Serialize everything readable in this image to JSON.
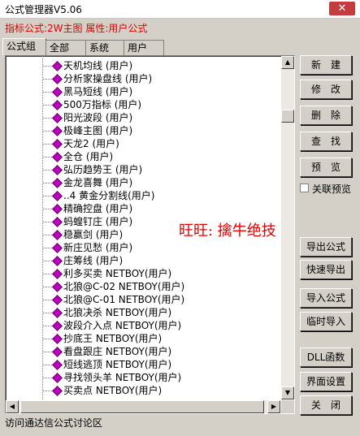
{
  "window": {
    "title": "公式管理器V5.06",
    "close_label": "✕"
  },
  "subtitle": "指标公式:2W主图 属性:用户公式",
  "tabs": [
    {
      "label": "公式组"
    },
    {
      "label": "全部"
    },
    {
      "label": "系统"
    },
    {
      "label": "用户"
    }
  ],
  "tree_items": [
    "天机均线  (用户)",
    "分析家操盘线  (用户)",
    "黑马短线  (用户)",
    "500万指标  (用户)",
    "阳光波段  (用户)",
    "极峰主图  (用户)",
    "天龙2  (用户)",
    "全仓  (用户)",
    "弘历趋势王  (用户)",
    "金龙喜舞  (用户)",
    "..4  黄金分割线(用户)",
    "精确控盘  (用户)",
    "蚂蝗钉庄  (用户)",
    "稳赢剑  (用户)",
    "新庄见愁  (用户)",
    "庄筹线  (用户)",
    "利多买卖  NETBOY(用户)",
    "北狼@C-02  NETBOY(用户)",
    "北狼@C-01  NETBOY(用户)",
    "北狼决杀  NETBOY(用户)",
    "波段介入点  NETBOY(用户)",
    "抄底王  NETBOY(用户)",
    "看盘跟庄  NETBOY(用户)",
    "短线逃顶  NETBOY(用户)",
    "寻找领头羊  NETBOY(用户)",
    "买卖点  NETBOY(用户)"
  ],
  "buttons": {
    "new": "新　建",
    "modify": "修　改",
    "delete": "删　除",
    "find": "查　找",
    "preview": "预　览",
    "export": "导出公式",
    "quick_export": "快速导出",
    "import": "导入公式",
    "temp_import": "临时导入",
    "dll": "DLL函数",
    "ui_settings": "界面设置",
    "close": "关　闭"
  },
  "linked_preview": {
    "label": "关联预览",
    "checked": false
  },
  "watermark": "旺旺: 擒牛绝技",
  "status": "访问通达信公式讨论区",
  "colors": {
    "accent_red": "#e00000",
    "node_magenta": "#c000c0"
  }
}
